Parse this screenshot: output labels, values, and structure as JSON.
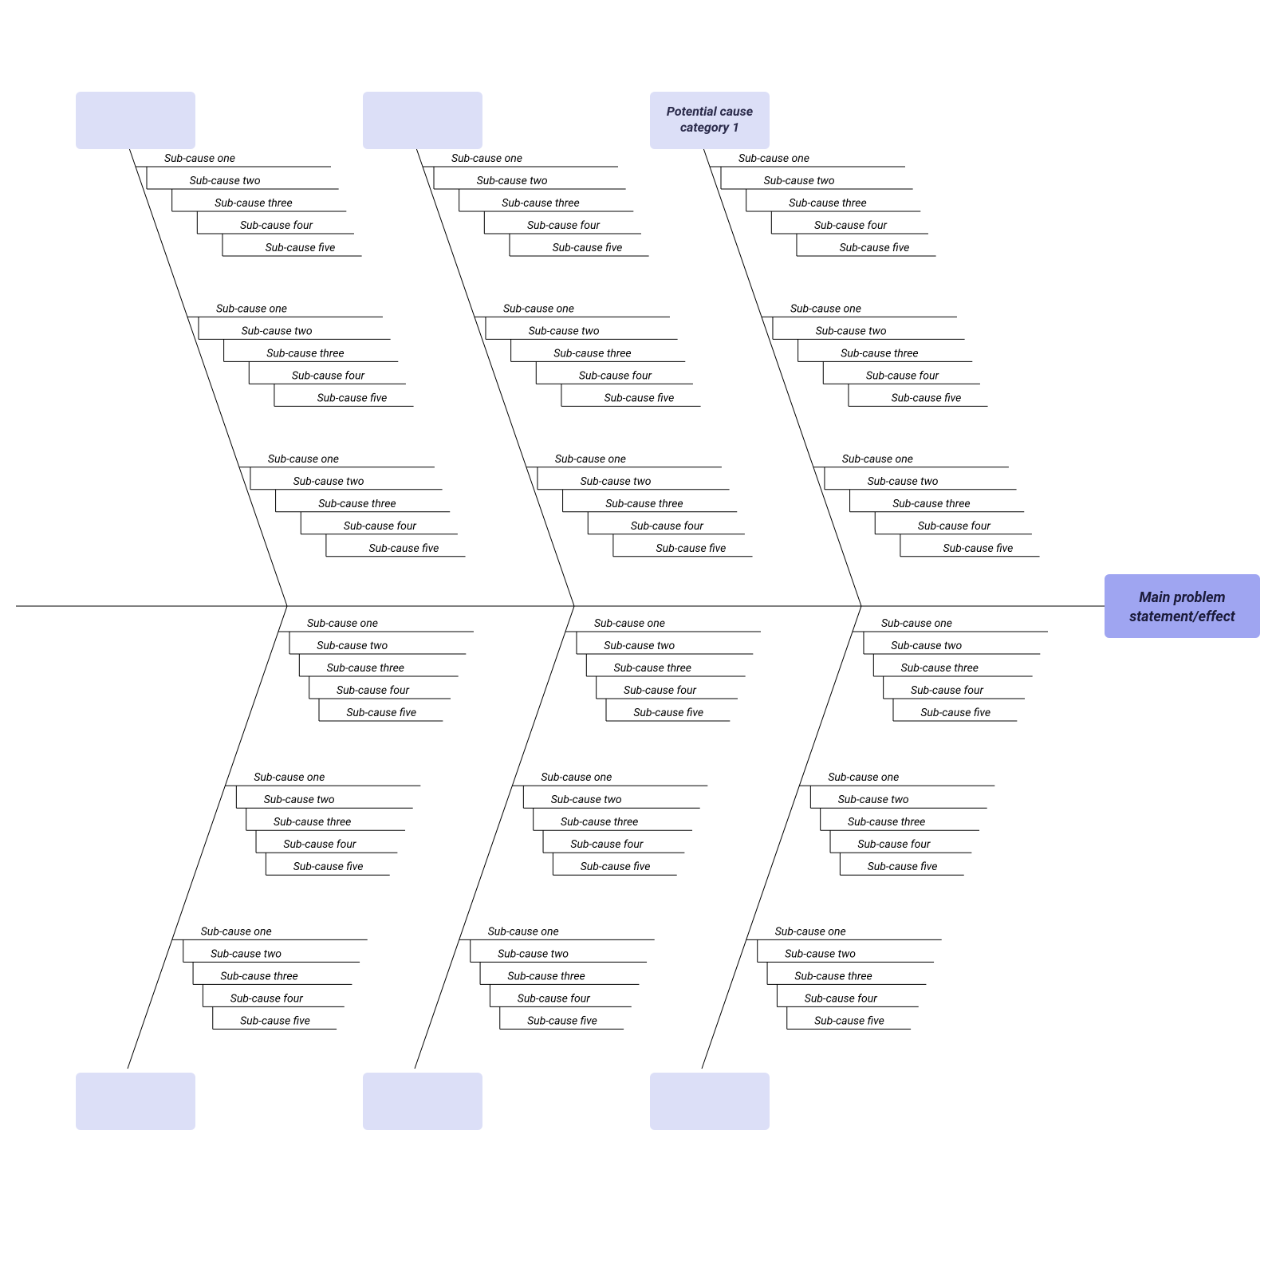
{
  "head": {
    "line1": "Main problem",
    "line2": "statement/effect"
  },
  "categories": {
    "top": [
      {
        "label_line1": "",
        "label_line2": ""
      },
      {
        "label_line1": "",
        "label_line2": ""
      },
      {
        "label_line1": "Potential cause",
        "label_line2": "category 1"
      }
    ],
    "bottom": [
      {
        "label_line1": "",
        "label_line2": ""
      },
      {
        "label_line1": "",
        "label_line2": ""
      },
      {
        "label_line1": "",
        "label_line2": ""
      }
    ]
  },
  "subcauses": [
    "Sub-cause one",
    "Sub-cause two",
    "Sub-cause three",
    "Sub-cause four",
    "Sub-cause five"
  ],
  "colors": {
    "category_box": "#dcdff7",
    "head_box": "#9fa5f1",
    "line": "#000000"
  }
}
